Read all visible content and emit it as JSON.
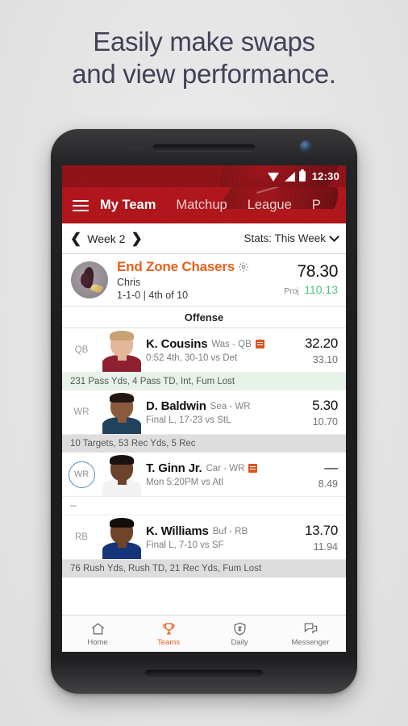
{
  "headline": {
    "line1": "Easily make swaps",
    "line2": "and view performance."
  },
  "statusbar": {
    "time": "12:30",
    "wifi_icon": "wifi-icon",
    "signal_icon": "signal-icon",
    "battery_icon": "battery-icon"
  },
  "appbar": {
    "menu_icon": "hamburger-menu-icon",
    "tabs": [
      {
        "label": "My Team",
        "active": true
      },
      {
        "label": "Matchup",
        "active": false
      },
      {
        "label": "League",
        "active": false
      },
      {
        "label": "P",
        "active": false
      }
    ]
  },
  "weekbar": {
    "prev_icon": "chevron-left-icon",
    "next_icon": "chevron-right-icon",
    "week_label": "Week 2",
    "stats_label": "Stats: This Week",
    "stats_caret_icon": "chevron-down-icon"
  },
  "team": {
    "avatar_name": "team-avatar",
    "name": "End Zone Chasers",
    "settings_icon": "gear-icon",
    "owner": "Chris",
    "record": "1-1-0 | 4th of 10",
    "score": "78.30",
    "proj_label": "Proj",
    "proj_value": "110.13",
    "proj_color": "#4cc47c",
    "accent_color": "#e8601c"
  },
  "section": {
    "offense_label": "Offense"
  },
  "players": [
    {
      "position": "QB",
      "position_selected": false,
      "name": "K. Cousins",
      "team_pos": "Was - QB",
      "has_news_badge": true,
      "game": "0:52 4th, 30-10 vs Det",
      "score": "32.20",
      "proj": "33.10",
      "statline": "231 Pass Yds, 4 Pass TD, Int, Fum Lost",
      "statline_state": "playing",
      "skin": "#e3b79a",
      "hair": "#c8a273",
      "jersey": "#8f2030"
    },
    {
      "position": "WR",
      "position_selected": false,
      "name": "D. Baldwin",
      "team_pos": "Sea - WR",
      "has_news_badge": false,
      "game": "Final L, 17-23 vs StL",
      "score": "5.30",
      "proj": "10.70",
      "statline": "10 Targets, 53 Rec Yds, 5 Rec",
      "statline_state": "final",
      "skin": "#8a5a3c",
      "hair": "#231713",
      "jersey": "#21415c"
    },
    {
      "position": "WR",
      "position_selected": true,
      "name": "T. Ginn Jr.",
      "team_pos": "Car - WR",
      "has_news_badge": true,
      "game": "Mon 5:20PM vs Atl",
      "score": "—",
      "proj": "8.49",
      "statline": "--",
      "statline_state": "none",
      "skin": "#6b432c",
      "hair": "#1a1210",
      "jersey": "#f2f2f2"
    },
    {
      "position": "RB",
      "position_selected": false,
      "name": "K. Williams",
      "team_pos": "Buf - RB",
      "has_news_badge": false,
      "game": "Final L, 7-10 vs SF",
      "score": "13.70",
      "proj": "11.94",
      "statline": "76 Rush Yds, Rush TD, 21 Rec Yds, Fum Lost",
      "statline_state": "final",
      "skin": "#6f4429",
      "hair": "#120c0a",
      "jersey": "#15357a"
    }
  ],
  "bottomnav": [
    {
      "label": "Home",
      "icon": "home-icon",
      "active": false
    },
    {
      "label": "Teams",
      "icon": "trophy-icon",
      "active": true
    },
    {
      "label": "Daily",
      "icon": "shield-dollar-icon",
      "active": false
    },
    {
      "label": "Messenger",
      "icon": "chat-bubbles-icon",
      "active": false
    }
  ]
}
